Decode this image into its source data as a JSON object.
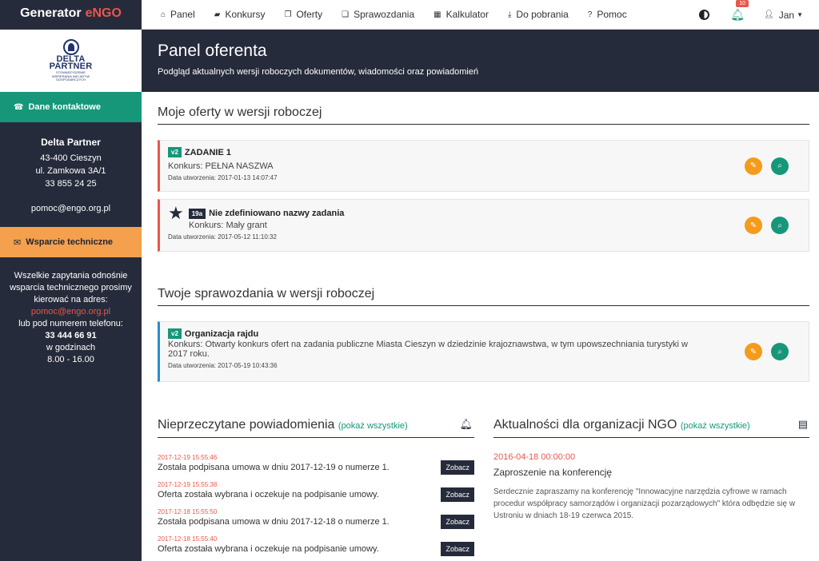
{
  "brand": {
    "name": "Generator",
    "accent": "eNGO"
  },
  "logo": {
    "name_line1": "DELTA",
    "name_line2": "PARTNER",
    "sub": "STOWARZYSZENIE WSPIERANIA INICJATYW GOSPODARCZYCH"
  },
  "sidebar": {
    "contact_label": "Dane kontaktowe",
    "org_name": "Delta Partner",
    "address1": "43-400 Cieszyn",
    "address2": "ul. Zamkowa 3A/1",
    "phone": "33 855 24 25",
    "email": "pomoc@engo.org.pl",
    "support_label": "Wsparcie techniczne",
    "support_text1": "Wszelkie zapytania odnośnie wsparcia technicznego prosimy kierować na adres:",
    "support_email": "pomoc@engo.org.pl",
    "support_text2": "lub pod numerem telefonu:",
    "support_phone": "33 444 66 91",
    "support_text3": "w godzinach",
    "support_hours": "8.00 - 16.00"
  },
  "nav": {
    "items": [
      {
        "label": "Panel",
        "icon": "home-icon",
        "glyph": "⌂"
      },
      {
        "label": "Konkursy",
        "icon": "book-icon",
        "glyph": "▰"
      },
      {
        "label": "Oferty",
        "icon": "files-icon",
        "glyph": "❐"
      },
      {
        "label": "Sprawozdania",
        "icon": "copy-icon",
        "glyph": "❏"
      },
      {
        "label": "Kalkulator",
        "icon": "calculator-icon",
        "glyph": "▦"
      },
      {
        "label": "Do pobrania",
        "icon": "download-icon",
        "glyph": "⤓"
      },
      {
        "label": "Pomoc",
        "icon": "help-icon",
        "glyph": "?"
      }
    ],
    "notif_count": "10",
    "user": "Jan"
  },
  "header": {
    "title": "Panel oferenta",
    "subtitle": "Podgląd aktualnych wersji roboczych dokumentów, wiadomości oraz powiadomień"
  },
  "offers": {
    "title": "Moje oferty w wersji roboczej",
    "items": [
      {
        "tag": "v2",
        "name": "ZADANIE 1",
        "konkurs": "Konkurs: PEŁNA NASZWA",
        "date": "Data utworzenia: 2017-01-13 14:07:47"
      },
      {
        "tag": "19a",
        "name": "Nie zdefiniowano nazwy zadania",
        "konkurs": "Konkurs: Mały grant",
        "date": "Data utworzenia: 2017-05-12 11:10:32"
      }
    ]
  },
  "reports": {
    "title": "Twoje sprawozdania w wersji roboczej",
    "items": [
      {
        "tag": "v2",
        "name": "Organizacja rajdu",
        "konkurs": "Konkurs: Otwarty konkurs ofert na zadania publiczne Miasta Cieszyn w dziedzinie krajoznawstwa, w tym upowszechniania turystyki w 2017 roku.",
        "date": "Data utworzenia: 2017-05-19 10:43:36"
      }
    ]
  },
  "notifications": {
    "title": "Nieprzeczytane powiadomienia",
    "more": "(pokaż wszystkie)",
    "button": "Zobacz",
    "items": [
      {
        "date": "2017-12-19 15:55:46",
        "text": "Została podpisana umowa w dniu 2017-12-19 o numerze 1."
      },
      {
        "date": "2017-12-19 15:55:38",
        "text": "Oferta została wybrana i oczekuje na podpisanie umowy."
      },
      {
        "date": "2017-12-18 15:55:50",
        "text": "Została podpisana umowa w dniu 2017-12-18 o numerze 1."
      },
      {
        "date": "2017-12-18 15:55:40",
        "text": "Oferta została wybrana i oczekuje na podpisanie umowy."
      }
    ]
  },
  "news": {
    "title": "Aktualności dla organizacji NGO",
    "more": "(pokaż wszystkie)",
    "date": "2016-04-18 00:00:00",
    "item_title": "Zaproszenie na konferencję",
    "text": "Serdecznie zapraszamy na konferencję \"Innowacyjne narzędzia cyfrowe w ramach procedur współpracy samorządów i organizacji pozarządowych\" która odbędzie się w Ustroniu w dniach 18-19 czerwca 2015."
  }
}
